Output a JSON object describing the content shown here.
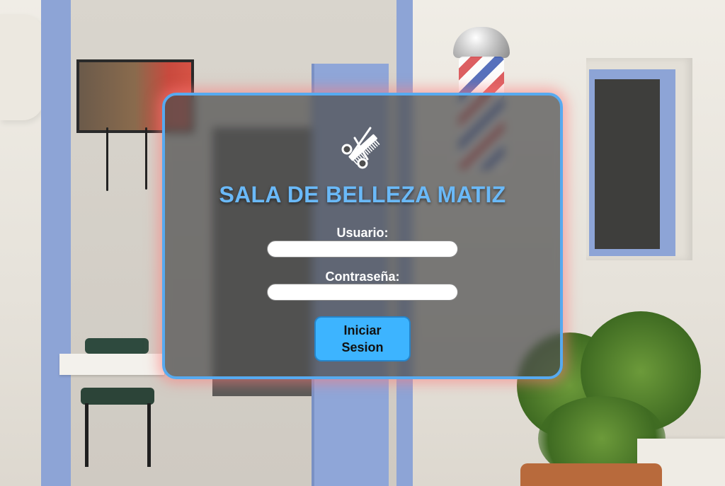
{
  "login": {
    "title": "SALA DE BELLEZA MATIZ",
    "logo_icon": "scissors-comb-icon",
    "username_label": "Usuario:",
    "username_value": "",
    "password_label": "Contraseña:",
    "password_value": "",
    "submit_label": "Iniciar Sesion"
  },
  "colors": {
    "panel_border": "#57aaf0",
    "title": "#6ab9f8",
    "button": "#3db4ff",
    "panel_glow": "#ff7878"
  }
}
